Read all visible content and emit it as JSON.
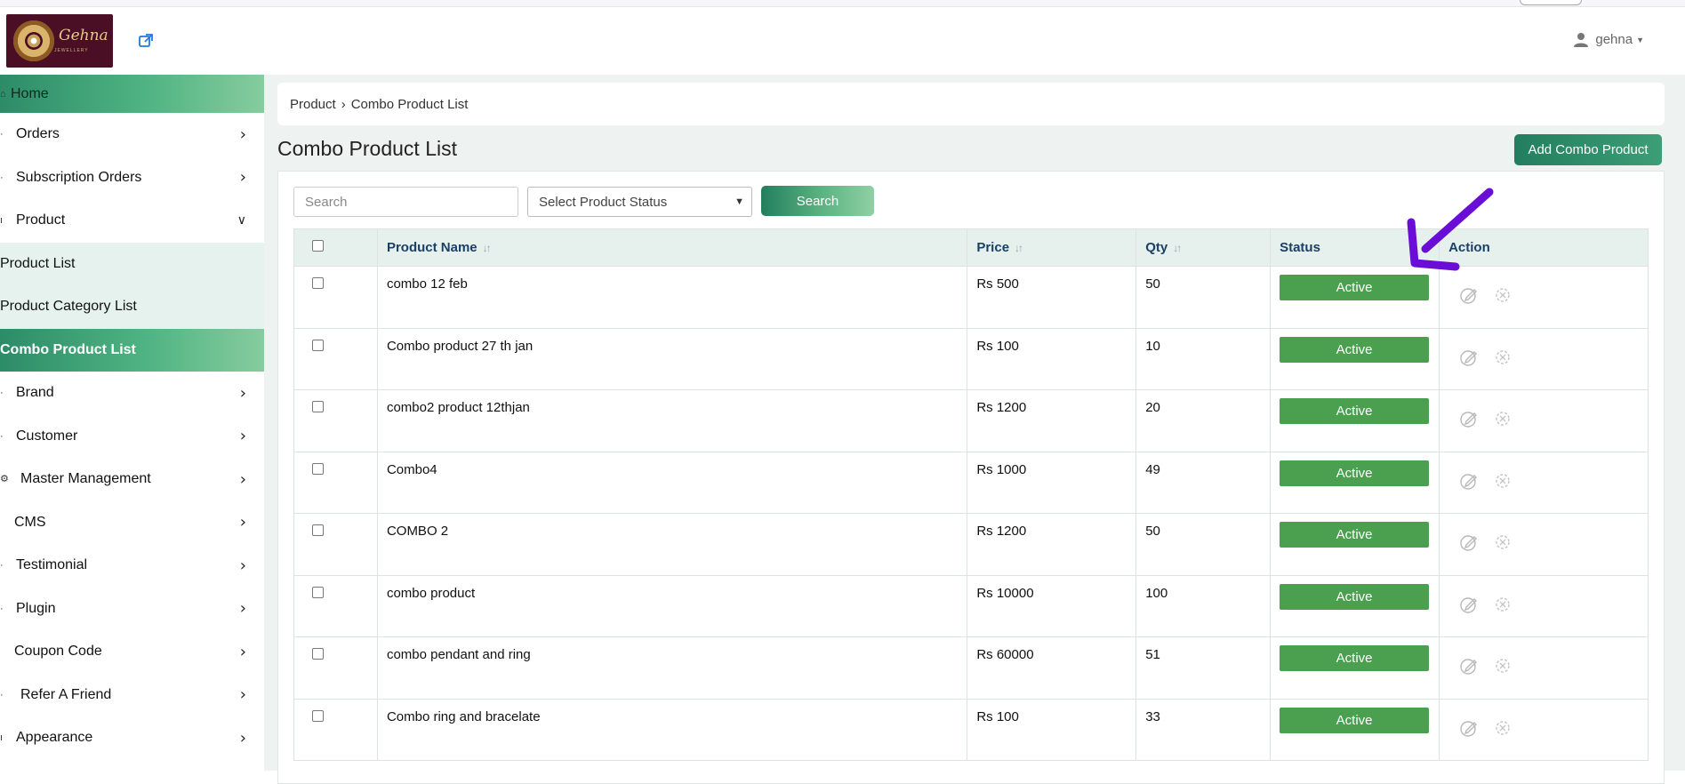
{
  "header": {
    "logo_text": "Gehna",
    "logo_subtext": "JEWELLERY",
    "user_name": "gehna"
  },
  "sidebar": {
    "items": [
      {
        "label": "Home",
        "icon": "home-icon"
      },
      {
        "label": "Orders"
      },
      {
        "label": "Subscription Orders"
      },
      {
        "label": "Product"
      }
    ],
    "product_sub": [
      "Product List",
      "Product Category List",
      "Combo Product List"
    ],
    "items_after": [
      {
        "label": "Brand"
      },
      {
        "label": "Customer"
      },
      {
        "label": "Master Management"
      },
      {
        "label": "CMS"
      },
      {
        "label": "Testimonial"
      },
      {
        "label": "Plugin"
      },
      {
        "label": "Coupon Code"
      },
      {
        "label": "Refer A Friend"
      },
      {
        "label": "Appearance"
      }
    ]
  },
  "breadcrumb": {
    "parent": "Product",
    "separator": "›",
    "current": "Combo Product List"
  },
  "page": {
    "title": "Combo Product List",
    "add_button": "Add Combo Product"
  },
  "filters": {
    "search_placeholder": "Search",
    "status_select": "Select Product Status",
    "search_button": "Search"
  },
  "table": {
    "headers": {
      "name": "Product Name",
      "price": "Price",
      "qty": "Qty",
      "status": "Status",
      "action": "Action"
    },
    "rows": [
      {
        "name": "combo 12 feb",
        "price": "Rs 500",
        "qty": "50",
        "status": "Active"
      },
      {
        "name": "Combo product 27 th jan",
        "price": "Rs 100",
        "qty": "10",
        "status": "Active"
      },
      {
        "name": "combo2 product 12thjan",
        "price": "Rs 1200",
        "qty": "20",
        "status": "Active"
      },
      {
        "name": "Combo4",
        "price": "Rs 1000",
        "qty": "49",
        "status": "Active"
      },
      {
        "name": "COMBO 2",
        "price": "Rs 1200",
        "qty": "50",
        "status": "Active"
      },
      {
        "name": "combo product",
        "price": "Rs 10000",
        "qty": "100",
        "status": "Active"
      },
      {
        "name": "combo pendant and ring",
        "price": "Rs 60000",
        "qty": "51",
        "status": "Active"
      },
      {
        "name": "Combo ring and bracelate",
        "price": "Rs 100",
        "qty": "33",
        "status": "Active"
      }
    ]
  },
  "colors": {
    "accent": "#2d8c68",
    "active_badge": "#4aa04f",
    "annotation_arrow": "#6a0dd6"
  }
}
